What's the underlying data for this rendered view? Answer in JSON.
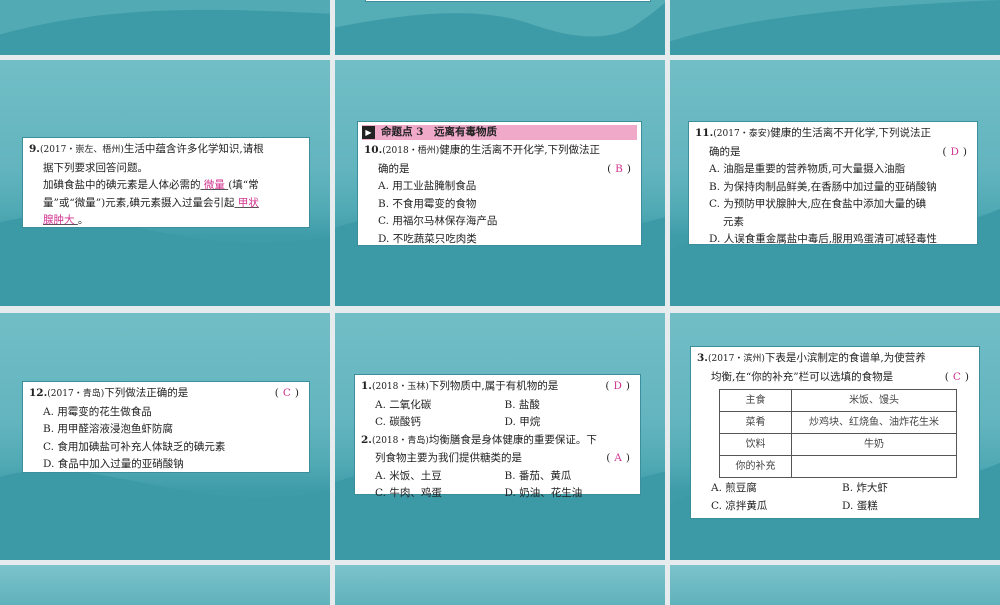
{
  "slides": {
    "s9": {
      "num": "9.",
      "src": "(2017・崇左、梧州)",
      "text1": "生活中蕴含许多化学知识,请根",
      "text2": "据下列要求回答问题。",
      "text3a": "加碘食盐中的碘元素是人体必需的",
      "blank1": "  微量  ",
      "text3b": "(填“常",
      "text4a": "量”或“微量”)元素,碘元素摄入过量会引起",
      "blank2a": "  甲状",
      "blank2b": "腺肿大  ",
      "text5": "。"
    },
    "s10": {
      "header_icon": "▶",
      "header": "命题点 3　远离有毒物质",
      "num": "10.",
      "src": "(2018・梧州)",
      "stem1": "健康的生活离不开化学,下列做法正",
      "stem2": "确的是",
      "answer": "B",
      "options": [
        "A. 用工业盐腌制食品",
        "B. 不食用霉变的食物",
        "C. 用福尔马林保存海产品",
        "D. 不吃蔬菜只吃肉类"
      ]
    },
    "s11": {
      "num": "11.",
      "src": "(2017・泰安)",
      "stem1": "健康的生活离不开化学,下列说法正",
      "stem2": "确的是",
      "answer": "D",
      "options": [
        "A. 油脂是重要的营养物质,可大量摄入油脂",
        "B. 为保持肉制品鲜美,在香肠中加过量的亚硝酸钠",
        "C. 为预防甲状腺肿大,应在食盐中添加大量的碘",
        "元素",
        "D. 人误食重金属盐中毒后,服用鸡蛋清可减轻毒性"
      ]
    },
    "s12": {
      "num": "12.",
      "src": "(2017・青岛)",
      "stem": "下列做法正确的是",
      "answer": "C",
      "options": [
        "A. 用霉变的花生做食品",
        "B. 用甲醛溶液浸泡鱼虾防腐",
        "C. 食用加碘盐可补充人体缺乏的碘元素",
        "D. 食品中加入过量的亚硝酸钠"
      ]
    },
    "s1": {
      "q1num": "1.",
      "q1src": "(2018・玉林)",
      "q1stem": "下列物质中,属于有机物的是",
      "q1answer": "D",
      "q1options": [
        "A. 二氧化碳",
        "B. 盐酸",
        "C. 碳酸钙",
        "D. 甲烷"
      ],
      "q2num": "2.",
      "q2src": "(2018・青岛)",
      "q2stem1": "均衡膳食是身体健康的重要保证。下",
      "q2stem2": "列食物主要为我们提供糖类的是",
      "q2answer": "A",
      "q2options": [
        "A. 米饭、土豆",
        "B. 番茄、黄瓜",
        "C. 牛肉、鸡蛋",
        "D. 奶油、花生油"
      ]
    },
    "s3": {
      "num": "3.",
      "src": "(2017・滨州)",
      "stem1": "下表是小滨制定的食谱单,为使营养",
      "stem2": "均衡,在“你的补充”栏可以选填的食物是",
      "answer": "C",
      "table": [
        [
          "主食",
          "米饭、馒头"
        ],
        [
          "菜肴",
          "炒鸡块、红烧鱼、油炸花生米"
        ],
        [
          "饮料",
          "牛奶"
        ],
        [
          "你的补充",
          ""
        ]
      ],
      "options": [
        "A. 煎豆腐",
        "B. 炸大虾",
        "C. 凉拌黄瓜",
        "D. 蛋糕"
      ]
    }
  }
}
